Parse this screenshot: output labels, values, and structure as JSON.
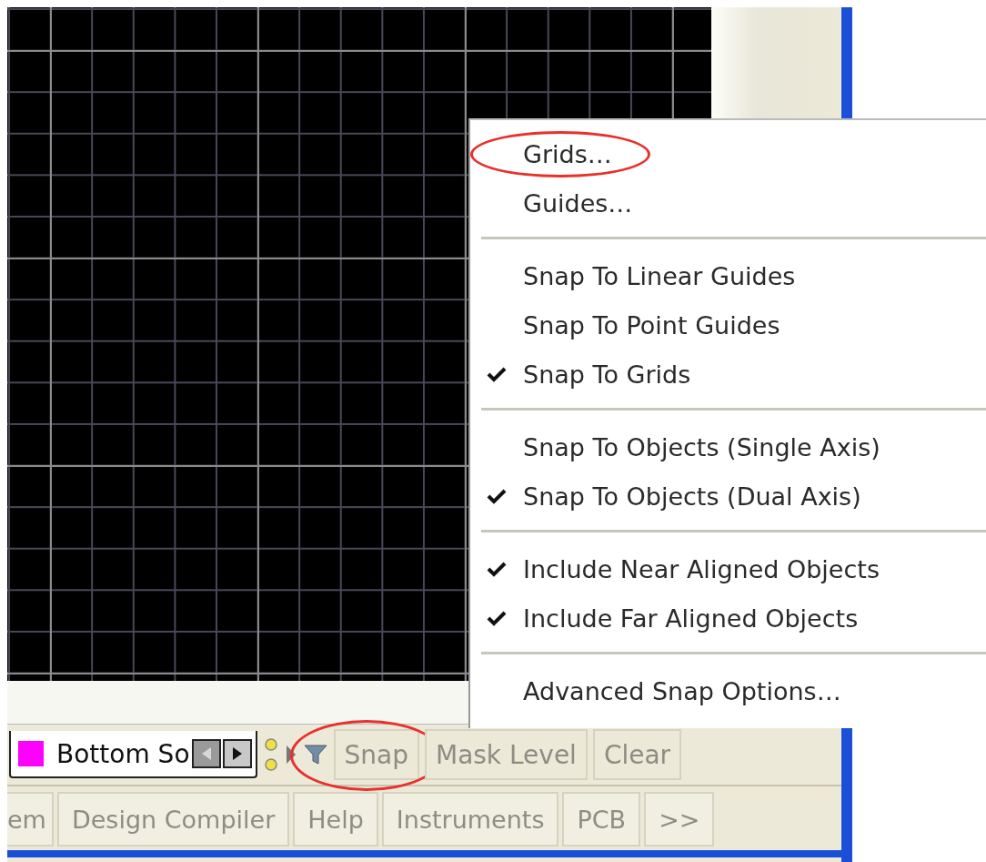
{
  "layer_tab": {
    "label": "Bottom So",
    "color": "#ff00ff"
  },
  "layer_toolbar": [
    {
      "label": "Snap",
      "annotated": true
    },
    {
      "label": "Mask Level",
      "annotated": false
    },
    {
      "label": "Clear",
      "annotated": false
    }
  ],
  "panel_bar": [
    "em",
    "Design Compiler",
    "Help",
    "Instruments",
    "PCB",
    ">>"
  ],
  "snap_menu": [
    {
      "kind": "item",
      "label": "Grids…",
      "checked": false,
      "annotated": true
    },
    {
      "kind": "item",
      "label": "Guides…",
      "checked": false,
      "annotated": false
    },
    {
      "kind": "separator"
    },
    {
      "kind": "item",
      "label": "Snap To Linear Guides",
      "checked": false,
      "annotated": false
    },
    {
      "kind": "item",
      "label": "Snap To Point Guides",
      "checked": false,
      "annotated": false
    },
    {
      "kind": "item",
      "label": "Snap To Grids",
      "checked": true,
      "annotated": false
    },
    {
      "kind": "separator"
    },
    {
      "kind": "item",
      "label": "Snap To Objects (Single Axis)",
      "checked": false,
      "annotated": false
    },
    {
      "kind": "item",
      "label": "Snap To Objects (Dual Axis)",
      "checked": true,
      "annotated": false
    },
    {
      "kind": "separator"
    },
    {
      "kind": "item",
      "label": "Include Near Aligned Objects",
      "checked": true,
      "annotated": false
    },
    {
      "kind": "item",
      "label": "Include Far Aligned Objects",
      "checked": true,
      "annotated": false
    },
    {
      "kind": "separator"
    },
    {
      "kind": "item",
      "label": "Advanced Snap Options…",
      "checked": false,
      "annotated": false
    }
  ]
}
